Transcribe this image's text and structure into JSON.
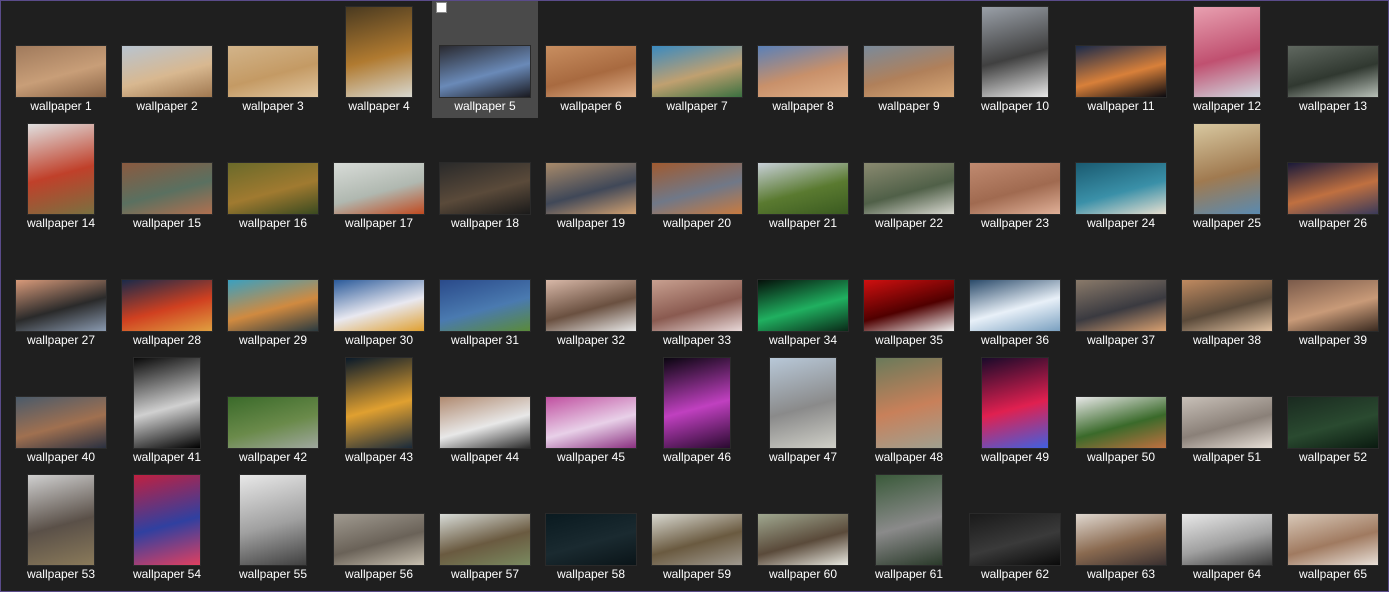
{
  "window": {
    "accent_border": "#5a4b8a",
    "background": "#1f1f1f"
  },
  "files": [
    {
      "label": "wallpaper 1",
      "orientation": "landscape",
      "colors": [
        "#a07a5c",
        "#c89e78",
        "#8a6446"
      ]
    },
    {
      "label": "wallpaper 2",
      "orientation": "landscape",
      "colors": [
        "#b8c4d0",
        "#d8b890",
        "#a07850"
      ]
    },
    {
      "label": "wallpaper 3",
      "orientation": "landscape",
      "colors": [
        "#d2b48a",
        "#c49a64",
        "#e0c6a0"
      ]
    },
    {
      "label": "wallpaper 4",
      "orientation": "portrait",
      "colors": [
        "#4a3a20",
        "#b07a30",
        "#d8d8d0"
      ]
    },
    {
      "label": "wallpaper 5",
      "orientation": "landscape",
      "colors": [
        "#2a2a30",
        "#6a8ab8",
        "#1a1a20"
      ],
      "selected": true
    },
    {
      "label": "wallpaper 6",
      "orientation": "landscape",
      "colors": [
        "#c88e60",
        "#a86a40",
        "#e0b08a"
      ]
    },
    {
      "label": "wallpaper 7",
      "orientation": "landscape",
      "colors": [
        "#3a8ac0",
        "#c0a070",
        "#3a7040"
      ]
    },
    {
      "label": "wallpaper 8",
      "orientation": "landscape",
      "colors": [
        "#5a80b8",
        "#c8906a",
        "#e0b088"
      ]
    },
    {
      "label": "wallpaper 9",
      "orientation": "landscape",
      "colors": [
        "#7a8a9a",
        "#b0805a",
        "#d8a878"
      ]
    },
    {
      "label": "wallpaper 10",
      "orientation": "portrait",
      "colors": [
        "#9aa0a8",
        "#404040",
        "#e8e8e8"
      ]
    },
    {
      "label": "wallpaper 11",
      "orientation": "landscape",
      "colors": [
        "#1a2a4a",
        "#d8803a",
        "#0a0a10"
      ]
    },
    {
      "label": "wallpaper 12",
      "orientation": "portrait",
      "colors": [
        "#e8a0b0",
        "#c05070",
        "#d0d8e0"
      ]
    },
    {
      "label": "wallpaper 13",
      "orientation": "landscape",
      "colors": [
        "#606860",
        "#303830",
        "#b8c0b8"
      ]
    },
    {
      "label": "wallpaper 14",
      "orientation": "portrait",
      "colors": [
        "#e0e0e0",
        "#c0402a",
        "#7a7040"
      ]
    },
    {
      "label": "wallpaper 15",
      "orientation": "landscape",
      "colors": [
        "#8a5a40",
        "#5a7060",
        "#b07050"
      ]
    },
    {
      "label": "wallpaper 16",
      "orientation": "landscape",
      "colors": [
        "#6a6a2a",
        "#a07a30",
        "#3a4a20"
      ]
    },
    {
      "label": "wallpaper 17",
      "orientation": "landscape",
      "colors": [
        "#d8dcd8",
        "#b0b8b0",
        "#c04a20"
      ]
    },
    {
      "label": "wallpaper 18",
      "orientation": "landscape",
      "colors": [
        "#2a2a2a",
        "#5a4a3a",
        "#1a1a1a"
      ]
    },
    {
      "label": "wallpaper 19",
      "orientation": "landscape",
      "colors": [
        "#a88a6a",
        "#404858",
        "#d0a070"
      ]
    },
    {
      "label": "wallpaper 20",
      "orientation": "landscape",
      "colors": [
        "#a05a30",
        "#707888",
        "#c87a40"
      ]
    },
    {
      "label": "wallpaper 21",
      "orientation": "landscape",
      "colors": [
        "#c8d0d8",
        "#5a7a30",
        "#3a5a20"
      ]
    },
    {
      "label": "wallpaper 22",
      "orientation": "landscape",
      "colors": [
        "#8a8a70",
        "#506048",
        "#d8d8d0"
      ]
    },
    {
      "label": "wallpaper 23",
      "orientation": "landscape",
      "colors": [
        "#c08a70",
        "#a06a50",
        "#e0b098"
      ]
    },
    {
      "label": "wallpaper 24",
      "orientation": "landscape",
      "colors": [
        "#1a5a70",
        "#3a90a8",
        "#e8e0d0"
      ]
    },
    {
      "label": "wallpaper 25",
      "orientation": "portrait",
      "colors": [
        "#d8c8a0",
        "#a07a50",
        "#5a8ab0"
      ]
    },
    {
      "label": "wallpaper 26",
      "orientation": "landscape",
      "colors": [
        "#1a1a3a",
        "#c07040",
        "#3a3a5a"
      ]
    },
    {
      "label": "wallpaper 27",
      "orientation": "landscape",
      "colors": [
        "#d89a7a",
        "#2a2a2a",
        "#8a9ab0"
      ]
    },
    {
      "label": "wallpaper 28",
      "orientation": "landscape",
      "colors": [
        "#1a2a4a",
        "#d04020",
        "#e0a040"
      ]
    },
    {
      "label": "wallpaper 29",
      "orientation": "landscape",
      "colors": [
        "#3aa0c0",
        "#d08a40",
        "#2a3a40"
      ]
    },
    {
      "label": "wallpaper 30",
      "orientation": "landscape",
      "colors": [
        "#2a5a9a",
        "#e8e8f0",
        "#e0a030"
      ]
    },
    {
      "label": "wallpaper 31",
      "orientation": "landscape",
      "colors": [
        "#2a4a8a",
        "#4a7ab0",
        "#5a8a3a"
      ]
    },
    {
      "label": "wallpaper 32",
      "orientation": "landscape",
      "colors": [
        "#d8b8a8",
        "#6a5040",
        "#e8e8e8"
      ]
    },
    {
      "label": "wallpaper 33",
      "orientation": "landscape",
      "colors": [
        "#c8a090",
        "#8a5a50",
        "#e8d8d8"
      ]
    },
    {
      "label": "wallpaper 34",
      "orientation": "landscape",
      "colors": [
        "#05100a",
        "#20b060",
        "#0a2a18"
      ]
    },
    {
      "label": "wallpaper 35",
      "orientation": "landscape",
      "colors": [
        "#d01010",
        "#500000",
        "#f0f0f0"
      ]
    },
    {
      "label": "wallpaper 36",
      "orientation": "landscape",
      "colors": [
        "#2a4a6a",
        "#e8f0f8",
        "#7aa0c0"
      ]
    },
    {
      "label": "wallpaper 37",
      "orientation": "landscape",
      "colors": [
        "#8a7a6a",
        "#3a3a40",
        "#d8a070"
      ]
    },
    {
      "label": "wallpaper 38",
      "orientation": "landscape",
      "colors": [
        "#c08a60",
        "#5a4a3a",
        "#e0c0a0"
      ]
    },
    {
      "label": "wallpaper 39",
      "orientation": "landscape",
      "colors": [
        "#7a5a4a",
        "#c89a78",
        "#3a2a20"
      ]
    },
    {
      "label": "wallpaper 40",
      "orientation": "landscape",
      "colors": [
        "#4a5a6a",
        "#a07050",
        "#2a3040"
      ]
    },
    {
      "label": "wallpaper 41",
      "orientation": "portrait",
      "colors": [
        "#0a0a0a",
        "#d0d0d0",
        "#000000"
      ]
    },
    {
      "label": "wallpaper 42",
      "orientation": "landscape",
      "colors": [
        "#3a6a2a",
        "#6a8a4a",
        "#a0a8a0"
      ]
    },
    {
      "label": "wallpaper 43",
      "orientation": "portrait",
      "colors": [
        "#0a1a2a",
        "#e0a030",
        "#1a2a3a"
      ]
    },
    {
      "label": "wallpaper 44",
      "orientation": "landscape",
      "colors": [
        "#b08a70",
        "#e8e8e8",
        "#2a2a2a"
      ]
    },
    {
      "label": "wallpaper 45",
      "orientation": "landscape",
      "colors": [
        "#c050a0",
        "#e8d0e8",
        "#8a3080"
      ]
    },
    {
      "label": "wallpaper 46",
      "orientation": "portrait",
      "colors": [
        "#0a0510",
        "#c040c0",
        "#2a0a30"
      ]
    },
    {
      "label": "wallpaper 47",
      "orientation": "portrait",
      "colors": [
        "#b8c8d8",
        "#8a8a8a",
        "#d0d0c8"
      ]
    },
    {
      "label": "wallpaper 48",
      "orientation": "portrait",
      "colors": [
        "#6a7a5a",
        "#c8805a",
        "#a0a090"
      ]
    },
    {
      "label": "wallpaper 49",
      "orientation": "portrait",
      "colors": [
        "#1a0a2a",
        "#e02050",
        "#4060e0"
      ]
    },
    {
      "label": "wallpaper 50",
      "orientation": "landscape",
      "colors": [
        "#e8e8e8",
        "#3a6a2a",
        "#c07040"
      ]
    },
    {
      "label": "wallpaper 51",
      "orientation": "landscape",
      "colors": [
        "#c8c0b8",
        "#8a8078",
        "#e8e0d8"
      ]
    },
    {
      "label": "wallpaper 52",
      "orientation": "landscape",
      "colors": [
        "#1a2a20",
        "#2a4a30",
        "#0a1a10"
      ]
    },
    {
      "label": "wallpaper 53",
      "orientation": "portrait",
      "colors": [
        "#d0d0d0",
        "#5a5048",
        "#8a7a5a"
      ]
    },
    {
      "label": "wallpaper 54",
      "orientation": "portrait",
      "colors": [
        "#c02040",
        "#3040a0",
        "#e04060"
      ]
    },
    {
      "label": "wallpaper 55",
      "orientation": "portrait",
      "colors": [
        "#e8e8e8",
        "#a0a0a0",
        "#404040"
      ]
    },
    {
      "label": "wallpaper 56",
      "orientation": "landscape",
      "colors": [
        "#a09a90",
        "#6a6258",
        "#c8c0b0"
      ]
    },
    {
      "label": "wallpaper 57",
      "orientation": "landscape",
      "colors": [
        "#d8dcd8",
        "#6a5a40",
        "#7a8a60"
      ]
    },
    {
      "label": "wallpaper 58",
      "orientation": "landscape",
      "colors": [
        "#0a1a20",
        "#1a2a30",
        "#0a1418"
      ]
    },
    {
      "label": "wallpaper 59",
      "orientation": "landscape",
      "colors": [
        "#d8d8d0",
        "#6a5a40",
        "#a09a90"
      ]
    },
    {
      "label": "wallpaper 60",
      "orientation": "landscape",
      "colors": [
        "#a0a890",
        "#5a4a3a",
        "#e8e8e0"
      ]
    },
    {
      "label": "wallpaper 61",
      "orientation": "portrait",
      "colors": [
        "#3a5a3a",
        "#8a8a8a",
        "#2a3a2a"
      ]
    },
    {
      "label": "wallpaper 62",
      "orientation": "landscape",
      "colors": [
        "#1a1a1a",
        "#3a3a3a",
        "#0a0a0a"
      ]
    },
    {
      "label": "wallpaper 63",
      "orientation": "landscape",
      "colors": [
        "#e0d8d0",
        "#8a6a50",
        "#3a3030"
      ]
    },
    {
      "label": "wallpaper 64",
      "orientation": "landscape",
      "colors": [
        "#e8e8e8",
        "#a0a0a0",
        "#3a3a3a"
      ]
    },
    {
      "label": "wallpaper 65",
      "orientation": "landscape",
      "colors": [
        "#d8c8b8",
        "#a07a60",
        "#e8e0d8"
      ]
    }
  ]
}
